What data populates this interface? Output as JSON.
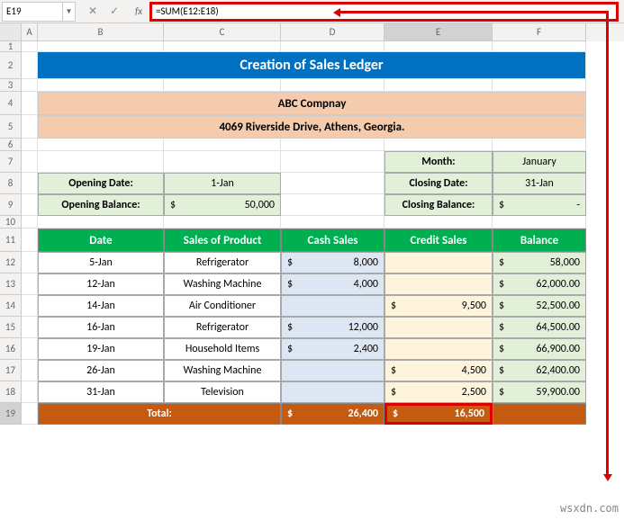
{
  "nameBox": "E19",
  "formula": "=SUM(E12:E18)",
  "cols": [
    "A",
    "B",
    "C",
    "D",
    "E",
    "F"
  ],
  "rows": [
    1,
    2,
    3,
    4,
    5,
    6,
    7,
    8,
    9,
    10,
    11,
    12,
    13,
    14,
    15,
    16,
    17,
    18,
    19
  ],
  "title": "Creation of Sales Ledger",
  "company": {
    "name": "ABC Compnay",
    "addr": "4069 Riverside Drive, Athens, Georgia."
  },
  "monthLabel": "Month:",
  "month": "January",
  "openDateLabel": "Opening Date:",
  "openDate": "1-Jan",
  "closeDateLabel": "Closing Date:",
  "closeDate": "31-Jan",
  "openBalLabel": "Opening Balance:",
  "openBal": "50,000",
  "closeBalLabel": "Closing Balance:",
  "closeBal": "-",
  "sym": "$",
  "headers": {
    "date": "Date",
    "product": "Sales of Product",
    "cash": "Cash Sales",
    "credit": "Credit Sales",
    "balance": "Balance"
  },
  "data": [
    {
      "date": "5-Jan",
      "product": "Refrigerator",
      "cash": "8,000",
      "credit": "",
      "balance": "58,000"
    },
    {
      "date": "12-Jan",
      "product": "Washing Machine",
      "cash": "4,000",
      "credit": "",
      "balance": "62,000.00"
    },
    {
      "date": "14-Jan",
      "product": "Air Conditioner",
      "cash": "",
      "credit": "9,500",
      "balance": "52,500.00"
    },
    {
      "date": "16-Jan",
      "product": "Refrigerator",
      "cash": "12,000",
      "credit": "",
      "balance": "64,500.00"
    },
    {
      "date": "19-Jan",
      "product": "Household Items",
      "cash": "2,400",
      "credit": "",
      "balance": "66,900.00"
    },
    {
      "date": "26-Jan",
      "product": "Washing Machine",
      "cash": "",
      "credit": "4,500",
      "balance": "62,400.00"
    },
    {
      "date": "31-Jan",
      "product": "Television",
      "cash": "",
      "credit": "2,500",
      "balance": "59,900.00"
    }
  ],
  "totalLabel": "Total:",
  "totalCash": "26,400",
  "totalCredit": "16,500",
  "watermark": "wsxdn.com"
}
